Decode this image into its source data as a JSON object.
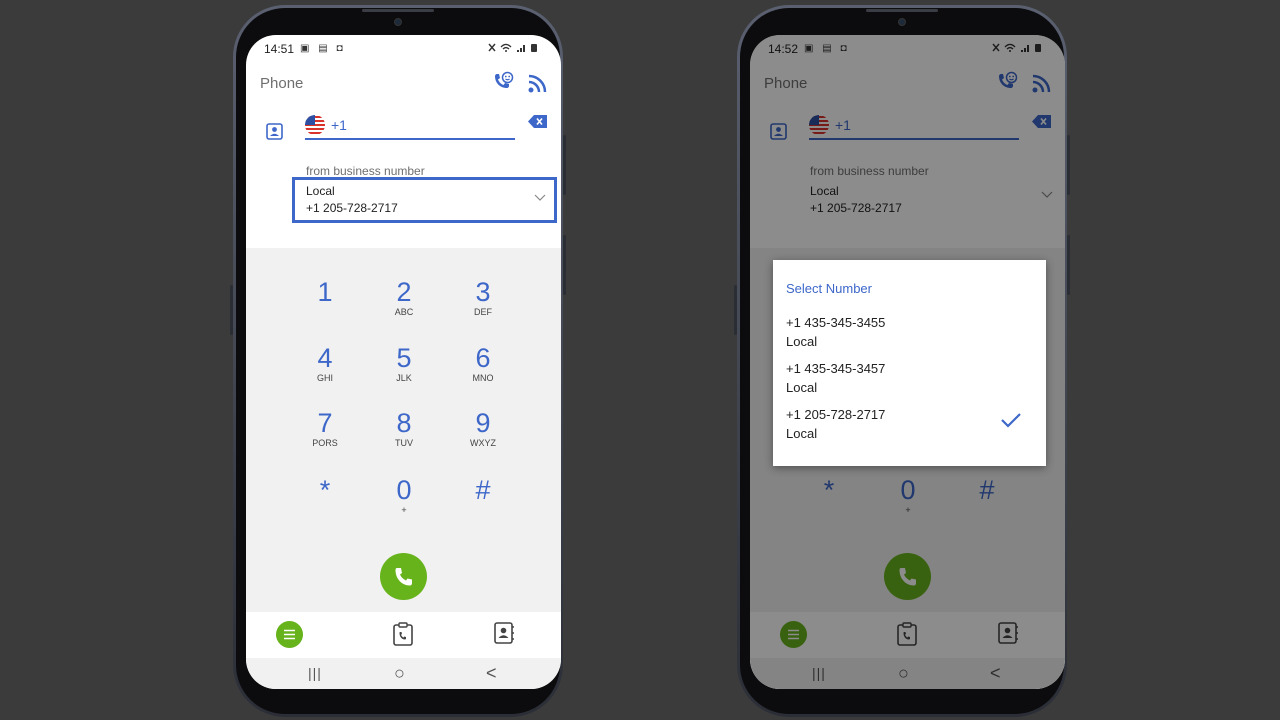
{
  "colors": {
    "accent": "#3d67c9",
    "call_green": "#67b31c",
    "highlight_border": "#3d67c9"
  },
  "screens": [
    {
      "status": {
        "time": "14:51"
      },
      "app_title": "Phone",
      "dial_prefix": "+1",
      "from_label": "from business number",
      "from_type": "Local",
      "from_number": "+1 205-728-2717"
    },
    {
      "status": {
        "time": "14:52"
      },
      "app_title": "Phone",
      "dial_prefix": "+1",
      "from_label": "from business number",
      "from_type": "Local",
      "from_number": "+1 205-728-2717",
      "dialog": {
        "title": "Select Number",
        "options": [
          {
            "number": "+1 435-345-3455",
            "type": "Local",
            "selected": false
          },
          {
            "number": "+1 435-345-3457",
            "type": "Local",
            "selected": false
          },
          {
            "number": "+1 205-728-2717",
            "type": "Local",
            "selected": true
          }
        ]
      }
    }
  ],
  "keypad": [
    {
      "digit": "1",
      "letters": ""
    },
    {
      "digit": "2",
      "letters": "ABC"
    },
    {
      "digit": "3",
      "letters": "DEF"
    },
    {
      "digit": "4",
      "letters": "GHI"
    },
    {
      "digit": "5",
      "letters": "JLK"
    },
    {
      "digit": "6",
      "letters": "MNO"
    },
    {
      "digit": "7",
      "letters": "PORS"
    },
    {
      "digit": "8",
      "letters": "TUV"
    },
    {
      "digit": "9",
      "letters": "WXYZ"
    },
    {
      "digit": "*",
      "letters": ""
    },
    {
      "digit": "0",
      "letters": "+"
    },
    {
      "digit": "#",
      "letters": ""
    }
  ],
  "sysnav": {
    "recents": "|||",
    "home": "○",
    "back": "<"
  }
}
